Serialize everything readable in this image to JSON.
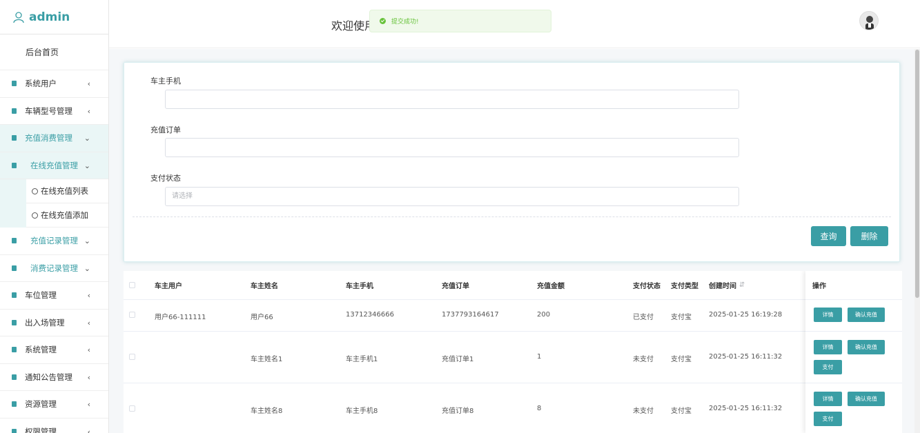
{
  "brand": {
    "name": "admin"
  },
  "header": {
    "welcome": "欢迎使用"
  },
  "toast": {
    "message": "提交成功!"
  },
  "sidebar": {
    "home": "后台首页",
    "items": [
      {
        "label": "系统用户"
      },
      {
        "label": "车辆型号管理"
      },
      {
        "label": "充值消费管理"
      },
      {
        "label": "在线充值管理"
      },
      {
        "label": "在线充值列表"
      },
      {
        "label": "在线充值添加"
      },
      {
        "label": "充值记录管理"
      },
      {
        "label": "消费记录管理"
      },
      {
        "label": "车位管理"
      },
      {
        "label": "出入场管理"
      },
      {
        "label": "系统管理"
      },
      {
        "label": "通知公告管理"
      },
      {
        "label": "资源管理"
      },
      {
        "label": "权限管理"
      }
    ]
  },
  "search": {
    "phone_label": "车主手机",
    "order_label": "充值订单",
    "status_label": "支付状态",
    "status_placeholder": "请选择",
    "query_button": "查询",
    "delete_button": "删除"
  },
  "table": {
    "headers": [
      "车主用户",
      "车主姓名",
      "车主手机",
      "充值订单",
      "充值金额",
      "支付状态",
      "支付类型",
      "创建时间",
      "操作"
    ],
    "rows": [
      {
        "user": "用户66-111111",
        "name": "用户66",
        "phone": "13712346666",
        "order": "1737793164617",
        "amount": "200",
        "status": "已支付",
        "type": "支付宝",
        "time": "2025-01-25 16:19:28"
      },
      {
        "user": "",
        "name": "车主姓名1",
        "phone": "车主手机1",
        "order": "充值订单1",
        "amount": "1",
        "status": "未支付",
        "type": "支付宝",
        "time": "2025-01-25 16:11:32"
      },
      {
        "user": "",
        "name": "车主姓名8",
        "phone": "车主手机8",
        "order": "充值订单8",
        "amount": "8",
        "status": "未支付",
        "type": "支付宝",
        "time": "2025-01-25 16:11:32"
      }
    ],
    "actions": {
      "detail": "详情",
      "confirm": "确认充值",
      "pay": "支付"
    }
  },
  "colors": {
    "accent": "#3a9ea5",
    "success": "#67c23a"
  }
}
